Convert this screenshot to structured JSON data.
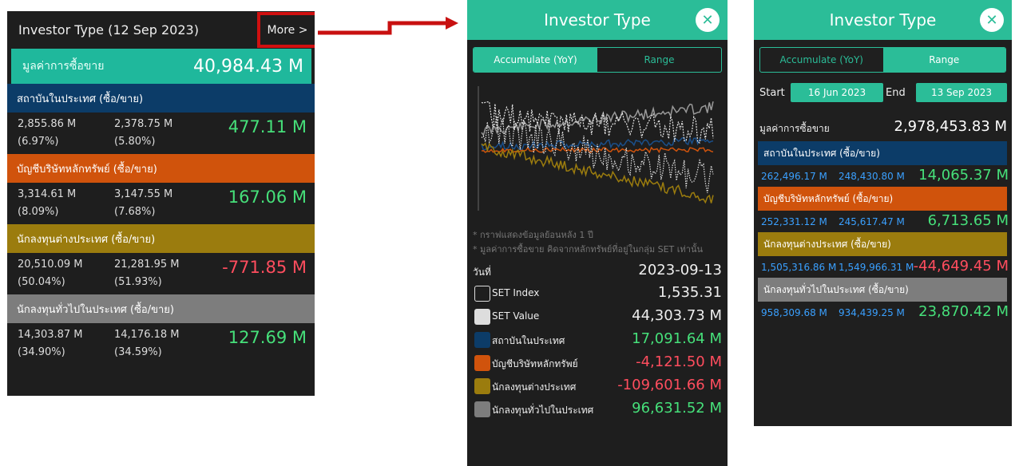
{
  "panel1": {
    "title": "Investor Type  (12 Sep 2023)",
    "more_label": "More >",
    "total_label": "มูลค่าการซื้อขาย",
    "total_value": "40,984.43 M",
    "rows": [
      {
        "label": "สถาบันในประเทศ (ซื้อ/ขาย)",
        "buy": "2,855.86 M",
        "buy_pct": "(6.97%)",
        "sell": "2,378.75 M",
        "sell_pct": "(5.80%)",
        "net": "477.11 M",
        "net_sign": "pos",
        "color": "#0c3c68"
      },
      {
        "label": "บัญชีบริษัทหลักทรัพย์ (ซื้อ/ขาย)",
        "buy": "3,314.61 M",
        "buy_pct": "(8.09%)",
        "sell": "3,147.55 M",
        "sell_pct": "(7.68%)",
        "net": "167.06 M",
        "net_sign": "pos",
        "color": "#d0530c"
      },
      {
        "label": "นักลงทุนต่างประเทศ (ซื้อ/ขาย)",
        "buy": "20,510.09 M",
        "buy_pct": "(50.04%)",
        "sell": "21,281.95 M",
        "sell_pct": "(51.93%)",
        "net": "-771.85 M",
        "net_sign": "neg",
        "color": "#9b7c0e"
      },
      {
        "label": "นักลงทุนทั่วไปในประเทศ (ซื้อ/ขาย)",
        "buy": "14,303.87 M",
        "buy_pct": "(34.90%)",
        "sell": "14,176.18 M",
        "sell_pct": "(34.59%)",
        "net": "127.69 M",
        "net_sign": "pos",
        "color": "#7d7d7d"
      }
    ]
  },
  "panel2": {
    "title": "Investor Type",
    "close_icon": "close-icon",
    "tab_accumulate": "Accumulate (YoY)",
    "tab_range": "Range",
    "note1": "* กราฟแสดงข้อมูลย้อนหลัง 1 ปี",
    "note2": "* มูลค่าการซื้อขาย คิดจากหลักทรัพย์ที่อยู่ในกลุ่ม SET เท่านั้น",
    "date_label": "วันที่",
    "date_value": "2023-09-13",
    "legend": [
      {
        "name": "SET Index",
        "value": "1,535.31",
        "color": "outline",
        "sign": "neutral"
      },
      {
        "name": "SET Value",
        "value": "44,303.73 M",
        "color": "#dddddd",
        "sign": "neutral"
      },
      {
        "name": "สถาบันในประเทศ",
        "value": "17,091.64 M",
        "color": "#0c3c68",
        "sign": "pos"
      },
      {
        "name": "บัญชีบริษัทหลักทรัพย์",
        "value": "-4,121.50 M",
        "color": "#d0530c",
        "sign": "neg"
      },
      {
        "name": "นักลงทุนต่างประเทศ",
        "value": "-109,601.66 M",
        "color": "#9b7c0e",
        "sign": "neg"
      },
      {
        "name": "นักลงทุนทั่วไปในประเทศ",
        "value": "96,631.52 M",
        "color": "#7d7d7d",
        "sign": "pos"
      }
    ]
  },
  "panel3": {
    "title": "Investor Type",
    "tab_accumulate": "Accumulate (YoY)",
    "tab_range": "Range",
    "start_label": "Start",
    "start_date": "16 Jun 2023",
    "end_label": "End",
    "end_date": "13 Sep 2023",
    "total_label": "มูลค่าการซื้อขาย",
    "total_value": "2,978,453.83 M",
    "rows": [
      {
        "label": "สถาบันในประเทศ (ซื้อ/ขาย)",
        "buy": "262,496.17 M",
        "sell": "248,430.80 M",
        "net": "14,065.37 M",
        "net_sign": "pos",
        "color": "#0c3c68"
      },
      {
        "label": "บัญชีบริษัทหลักทรัพย์ (ซื้อ/ขาย)",
        "buy": "252,331.12 M",
        "sell": "245,617.47 M",
        "net": "6,713.65 M",
        "net_sign": "pos",
        "color": "#d0530c"
      },
      {
        "label": "นักลงทุนต่างประเทศ (ซื้อ/ขาย)",
        "buy": "1,505,316.86 M",
        "sell": "1,549,966.31 M",
        "net": "-44,649.45 M",
        "net_sign": "neg",
        "color": "#9b7c0e"
      },
      {
        "label": "นักลงทุนทั่วไปในประเทศ (ซื้อ/ขาย)",
        "buy": "958,309.68 M",
        "sell": "934,439.25 M",
        "net": "23,870.42 M",
        "net_sign": "pos",
        "color": "#7d7d7d"
      }
    ]
  }
}
